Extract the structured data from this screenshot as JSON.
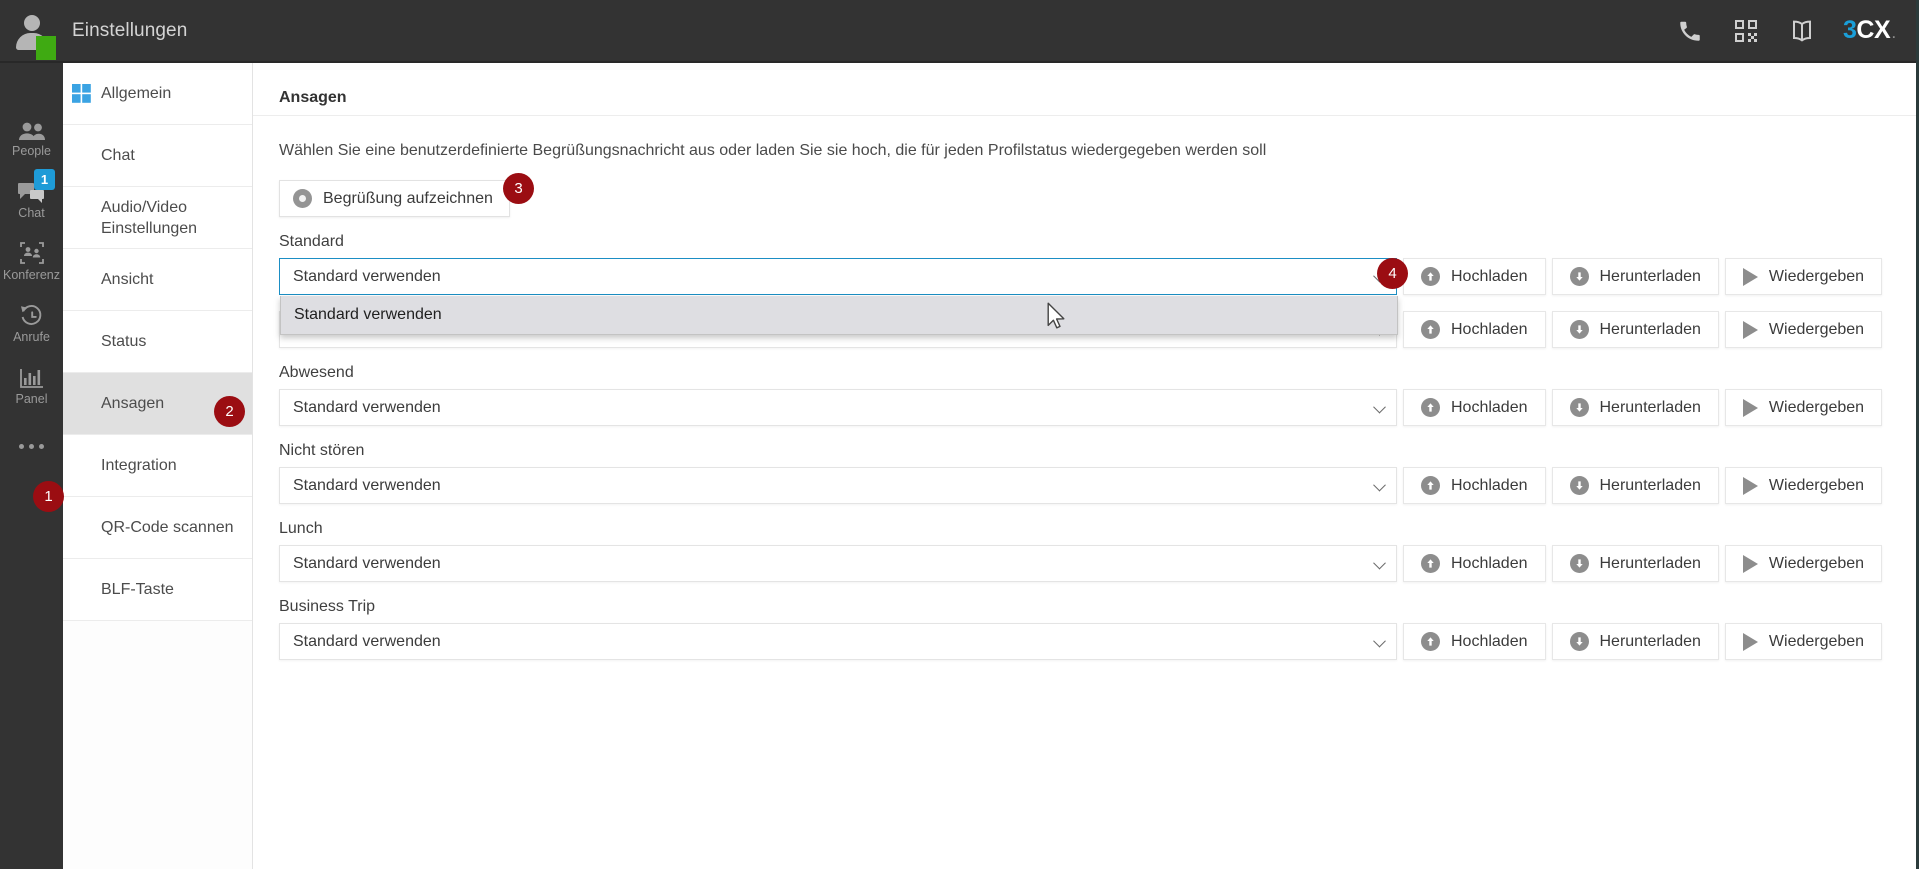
{
  "topbar": {
    "title": "Einstellungen",
    "icons": [
      {
        "name": "phone-icon"
      },
      {
        "name": "qr-code-icon"
      },
      {
        "name": "book-icon"
      }
    ],
    "logo": {
      "part1": "3",
      "part2": "CX",
      "dot": "."
    }
  },
  "rail": {
    "items": [
      {
        "icon": "people-icon",
        "label": "People",
        "badge": null
      },
      {
        "icon": "chat-icon",
        "label": "Chat",
        "badge": "1"
      },
      {
        "icon": "conference-icon",
        "label": "Konferenz",
        "badge": null
      },
      {
        "icon": "calls-history-icon",
        "label": "Anrufe",
        "badge": null
      },
      {
        "icon": "panel-chart-icon",
        "label": "Panel",
        "badge": null
      },
      {
        "icon": "more-dots-icon",
        "label": "",
        "badge": null
      }
    ]
  },
  "settings_nav": {
    "items": [
      {
        "label": "Allgemein",
        "icon": "windows-icon",
        "active": false
      },
      {
        "label": "Chat",
        "icon": "",
        "active": false
      },
      {
        "label": "Audio/Video Einstellungen",
        "icon": "",
        "active": false
      },
      {
        "label": "Ansicht",
        "icon": "",
        "active": false
      },
      {
        "label": "Status",
        "icon": "",
        "active": false
      },
      {
        "label": "Ansagen",
        "icon": "",
        "active": true
      },
      {
        "label": "Integration",
        "icon": "",
        "active": false
      },
      {
        "label": "QR-Code scannen",
        "icon": "",
        "active": false
      },
      {
        "label": "BLF-Taste",
        "icon": "",
        "active": false
      }
    ]
  },
  "main": {
    "heading": "Ansagen",
    "intro": "Wählen Sie eine benutzerdefinierte Begrüßungsnachricht aus oder laden Sie sie hoch, die für jeden Profilstatus wiedergegeben werden soll",
    "record_button": "Begrüßung aufzeichnen",
    "actions": {
      "upload": "Hochladen",
      "download": "Herunterladen",
      "play": "Wiedergeben"
    },
    "dropdown": {
      "open": true,
      "options": [
        "Standard verwenden"
      ],
      "selected": "Standard verwenden"
    },
    "rows": [
      {
        "label": "Standard",
        "value": "Standard verwenden",
        "open": true
      },
      {
        "label": "",
        "value": "Standard verwenden",
        "open": false
      },
      {
        "label": "Abwesend",
        "value": "Standard verwenden",
        "open": false
      },
      {
        "label": "Nicht stören",
        "value": "Standard verwenden",
        "open": false
      },
      {
        "label": "Lunch",
        "value": "Standard verwenden",
        "open": false
      },
      {
        "label": "Business Trip",
        "value": "Standard verwenden",
        "open": false
      }
    ]
  },
  "steps": [
    {
      "n": "1"
    },
    {
      "n": "2"
    },
    {
      "n": "3"
    },
    {
      "n": "4"
    }
  ],
  "colors": {
    "accent": "#1a9fd9",
    "step_badge": "#9b0d12",
    "topbar": "#333333",
    "active_nav": "#e0e0e0",
    "focus_border": "#1b8ec4",
    "presence_green": "#3faa12"
  }
}
